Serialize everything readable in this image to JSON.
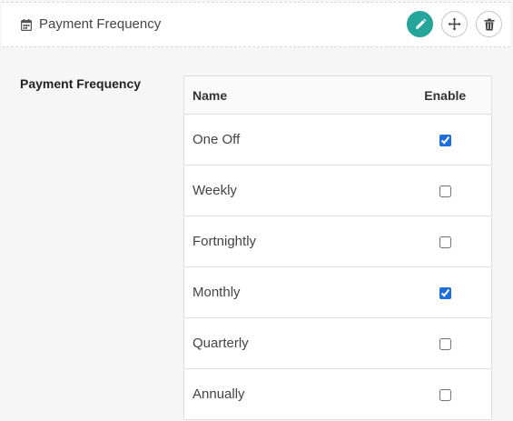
{
  "header": {
    "title": "Payment Frequency",
    "icon": "calendar-icon",
    "actions": [
      {
        "name": "edit",
        "icon": "pencil-icon",
        "color": "#26a69a"
      },
      {
        "name": "move",
        "icon": "move-arrows-icon"
      },
      {
        "name": "delete",
        "icon": "trash-icon"
      }
    ]
  },
  "section": {
    "label": "Payment Frequency"
  },
  "table": {
    "columns": {
      "name": "Name",
      "enable": "Enable"
    },
    "rows": [
      {
        "name": "One Off",
        "enabled": true
      },
      {
        "name": "Weekly",
        "enabled": false
      },
      {
        "name": "Fortnightly",
        "enabled": false
      },
      {
        "name": "Monthly",
        "enabled": true
      },
      {
        "name": "Quarterly",
        "enabled": false
      },
      {
        "name": "Annually",
        "enabled": false
      }
    ]
  }
}
